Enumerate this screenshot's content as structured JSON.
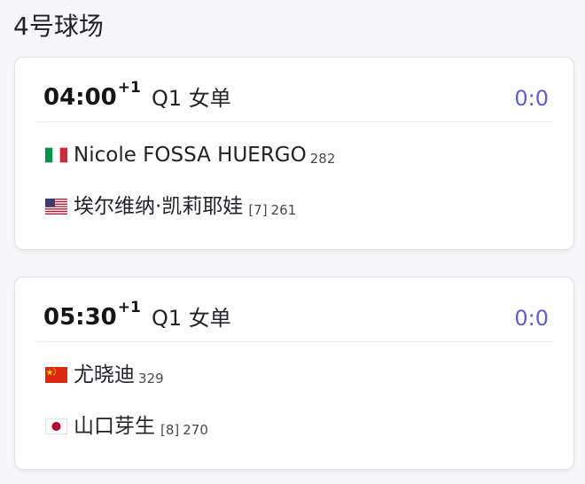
{
  "court": {
    "title": "4号球场"
  },
  "colors": {
    "score_accent": "#5a5ee0",
    "card_border": "#dde1ea",
    "page_background": "#f7f7f9"
  },
  "matches": [
    {
      "time": "04:00",
      "day_offset": "+1",
      "round": "Q1 女单",
      "score": "0:0",
      "players": [
        {
          "flag_icon": "flag-italy-icon",
          "name": "Nicole FOSSA HUERGO",
          "seed": "",
          "rank": "282"
        },
        {
          "flag_icon": "flag-usa-icon",
          "name": "埃尔维纳·凯莉耶娃",
          "seed": "[7]",
          "rank": "261"
        }
      ]
    },
    {
      "time": "05:30",
      "day_offset": "+1",
      "round": "Q1 女单",
      "score": "0:0",
      "players": [
        {
          "flag_icon": "flag-china-icon",
          "name": "尤晓迪",
          "seed": "",
          "rank": "329"
        },
        {
          "flag_icon": "flag-japan-icon",
          "name": "山口芽生",
          "seed": "[8]",
          "rank": "270"
        }
      ]
    }
  ]
}
